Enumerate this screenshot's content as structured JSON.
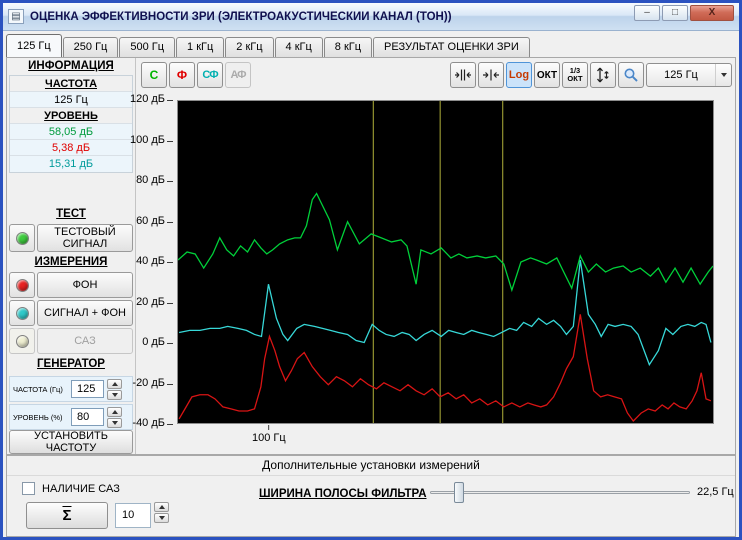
{
  "window": {
    "title": "ОЦЕНКА ЭФФЕКТИВНОСТИ ЗРИ (ЭЛЕКТРОАКУСТИЧЕСКИЙ КАНАЛ (ТОН))"
  },
  "icons": {
    "window_glyph": "▤",
    "minimize_glyph": "–",
    "maximize_glyph": "□",
    "close_glyph": "X"
  },
  "tabs": [
    {
      "label": "125 Гц",
      "active": true
    },
    {
      "label": "250 Гц",
      "active": false
    },
    {
      "label": "500 Гц",
      "active": false
    },
    {
      "label": "1 кГц",
      "active": false
    },
    {
      "label": "2 кГц",
      "active": false
    },
    {
      "label": "4 кГц",
      "active": false
    },
    {
      "label": "8 кГц",
      "active": false
    },
    {
      "label": "РЕЗУЛЬТАТ ОЦЕНКИ ЗРИ",
      "active": false
    }
  ],
  "sidebar": {
    "info_header": "ИНФОРМАЦИЯ",
    "frequency_header": "ЧАСТОТА",
    "frequency_value": "125 Гц",
    "level_header": "УРОВЕНЬ",
    "level_values": [
      {
        "text": "58,05 дБ",
        "color": "#009b3c"
      },
      {
        "text": "5,38 дБ",
        "color": "#e00000"
      },
      {
        "text": "15,31 дБ",
        "color": "#009b9b"
      }
    ],
    "test_header": "ТЕСТ",
    "test_led": "#3ecc3e",
    "test_button": "ТЕСТОВЫЙ СИГНАЛ",
    "measure_header": "ИЗМЕРЕНИЯ",
    "measure_buttons": [
      {
        "label": "ФОН",
        "led": "#e82222",
        "enabled": true
      },
      {
        "label": "СИГНАЛ + ФОН",
        "led": "#2fc9c9",
        "enabled": true
      },
      {
        "label": "САЗ",
        "led": "#efefd2",
        "enabled": false
      }
    ],
    "generator_header": "ГЕНЕРАТОР",
    "generator_fields": [
      {
        "label": "ЧАСТОТА (Гц)",
        "value": "125"
      },
      {
        "label": "УРОВЕНЬ (%)",
        "value": "80"
      }
    ],
    "set_frequency_button": "УСТАНОВИТЬ ЧАСТОТУ"
  },
  "toolbar": {
    "curve_toggles": [
      {
        "glyph": "С",
        "color": "#00b400",
        "enabled": true
      },
      {
        "glyph": "Ф",
        "color": "#e00000",
        "enabled": true
      },
      {
        "glyph": "СФ",
        "color": "#00b0b0",
        "enabled": true
      },
      {
        "glyph": "АФ",
        "color": "#ababab",
        "enabled": false
      }
    ],
    "log_button": "Log",
    "oct_button": "ОКТ",
    "third_oct_button": "1/3 ОКТ",
    "freq_dropdown": "125 Гц"
  },
  "chart_data": {
    "type": "line",
    "x_scale": "log",
    "background": "#000000",
    "ylim": [
      -40,
      120
    ],
    "grid": "off",
    "y_ticks": [
      {
        "value": 120,
        "label": "120 дБ"
      },
      {
        "value": 100,
        "label": "100 дБ"
      },
      {
        "value": 80,
        "label": "80 дБ"
      },
      {
        "value": 60,
        "label": "60 дБ"
      },
      {
        "value": 40,
        "label": "40 дБ"
      },
      {
        "value": 20,
        "label": "20 дБ"
      },
      {
        "value": 0,
        "label": "0 дБ"
      },
      {
        "value": -20,
        "label": "-20 дБ"
      },
      {
        "value": -40,
        "label": "-40 дБ"
      }
    ],
    "x_tick": {
      "fraction": 0.171,
      "label": "100 Гц"
    },
    "band_markers_fractions": [
      0.365,
      0.49,
      0.607
    ],
    "marker_color": "#b2b23a",
    "series": [
      {
        "name": "тестовый сигнал (С)",
        "color": "#00d03a",
        "points": [
          [
            0.0,
            41
          ],
          [
            0.017,
            45
          ],
          [
            0.032,
            44
          ],
          [
            0.048,
            37
          ],
          [
            0.065,
            44
          ],
          [
            0.078,
            52
          ],
          [
            0.091,
            46
          ],
          [
            0.104,
            43
          ],
          [
            0.117,
            48
          ],
          [
            0.13,
            45
          ],
          [
            0.143,
            51
          ],
          [
            0.155,
            47
          ],
          [
            0.166,
            44
          ],
          [
            0.177,
            46
          ],
          [
            0.19,
            49
          ],
          [
            0.205,
            51
          ],
          [
            0.218,
            52
          ],
          [
            0.229,
            52
          ],
          [
            0.24,
            58
          ],
          [
            0.251,
            71
          ],
          [
            0.259,
            74
          ],
          [
            0.283,
            61
          ],
          [
            0.298,
            46
          ],
          [
            0.317,
            60
          ],
          [
            0.339,
            49
          ],
          [
            0.361,
            54
          ],
          [
            0.38,
            52
          ],
          [
            0.399,
            50
          ],
          [
            0.417,
            51
          ],
          [
            0.428,
            48
          ],
          [
            0.445,
            29
          ],
          [
            0.454,
            46
          ],
          [
            0.473,
            44
          ],
          [
            0.492,
            47
          ],
          [
            0.51,
            42
          ],
          [
            0.525,
            44
          ],
          [
            0.54,
            42
          ],
          [
            0.559,
            43
          ],
          [
            0.575,
            42
          ],
          [
            0.594,
            43
          ],
          [
            0.609,
            39
          ],
          [
            0.624,
            26
          ],
          [
            0.641,
            40
          ],
          [
            0.659,
            42
          ],
          [
            0.67,
            41
          ],
          [
            0.689,
            39
          ],
          [
            0.708,
            42
          ],
          [
            0.736,
            27
          ],
          [
            0.752,
            43
          ],
          [
            0.767,
            35
          ],
          [
            0.782,
            39
          ],
          [
            0.799,
            35
          ],
          [
            0.814,
            37
          ],
          [
            0.832,
            38
          ],
          [
            0.847,
            35
          ],
          [
            0.864,
            37
          ],
          [
            0.883,
            33
          ],
          [
            0.898,
            37
          ],
          [
            0.912,
            30
          ],
          [
            0.929,
            37
          ],
          [
            0.944,
            30
          ],
          [
            0.959,
            37
          ],
          [
            0.976,
            29
          ],
          [
            0.991,
            35
          ],
          [
            1.0,
            38
          ]
        ]
      },
      {
        "name": "сигнал + фон (СФ)",
        "color": "#37d8d8",
        "points": [
          [
            0.002,
            5
          ],
          [
            0.022,
            6
          ],
          [
            0.041,
            6
          ],
          [
            0.06,
            7
          ],
          [
            0.078,
            7
          ],
          [
            0.093,
            8
          ],
          [
            0.112,
            7
          ],
          [
            0.128,
            6
          ],
          [
            0.143,
            4
          ],
          [
            0.156,
            3
          ],
          [
            0.169,
            29
          ],
          [
            0.184,
            12
          ],
          [
            0.196,
            4
          ],
          [
            0.205,
            1
          ],
          [
            0.222,
            7
          ],
          [
            0.236,
            9
          ],
          [
            0.255,
            8
          ],
          [
            0.27,
            7
          ],
          [
            0.285,
            6
          ],
          [
            0.3,
            5
          ],
          [
            0.317,
            4
          ],
          [
            0.333,
            1
          ],
          [
            0.348,
            0
          ],
          [
            0.363,
            9
          ],
          [
            0.376,
            6
          ],
          [
            0.389,
            4
          ],
          [
            0.404,
            3
          ],
          [
            0.419,
            5
          ],
          [
            0.432,
            4
          ],
          [
            0.445,
            1
          ],
          [
            0.46,
            4
          ],
          [
            0.475,
            6
          ],
          [
            0.492,
            3
          ],
          [
            0.506,
            6
          ],
          [
            0.52,
            5
          ],
          [
            0.534,
            4
          ],
          [
            0.549,
            6
          ],
          [
            0.562,
            5
          ],
          [
            0.577,
            4
          ],
          [
            0.59,
            3
          ],
          [
            0.605,
            5
          ],
          [
            0.62,
            7
          ],
          [
            0.633,
            6
          ],
          [
            0.646,
            10
          ],
          [
            0.661,
            8
          ],
          [
            0.674,
            12
          ],
          [
            0.689,
            9
          ],
          [
            0.702,
            11
          ],
          [
            0.715,
            8
          ],
          [
            0.726,
            4
          ],
          [
            0.739,
            8
          ],
          [
            0.752,
            41
          ],
          [
            0.767,
            14
          ],
          [
            0.78,
            9
          ],
          [
            0.791,
            3
          ],
          [
            0.804,
            9
          ],
          [
            0.817,
            8
          ],
          [
            0.832,
            9
          ],
          [
            0.847,
            8
          ],
          [
            0.86,
            4
          ],
          [
            0.881,
            -11
          ],
          [
            0.898,
            -4
          ],
          [
            0.912,
            7
          ],
          [
            0.925,
            4
          ],
          [
            0.94,
            8
          ],
          [
            0.953,
            9
          ],
          [
            0.966,
            8
          ],
          [
            0.978,
            10
          ],
          [
            0.987,
            9
          ],
          [
            0.996,
            0
          ]
        ]
      },
      {
        "name": "фон (Ф)",
        "color": "#d81414",
        "points": [
          [
            0.002,
            -38
          ],
          [
            0.013,
            -33
          ],
          [
            0.026,
            -27
          ],
          [
            0.041,
            -26
          ],
          [
            0.056,
            -26
          ],
          [
            0.069,
            -28
          ],
          [
            0.084,
            -32
          ],
          [
            0.099,
            -33
          ],
          [
            0.114,
            -34
          ],
          [
            0.13,
            -34
          ],
          [
            0.143,
            -33
          ],
          [
            0.155,
            -22
          ],
          [
            0.162,
            -8
          ],
          [
            0.171,
            3
          ],
          [
            0.181,
            -4
          ],
          [
            0.19,
            -12
          ],
          [
            0.201,
            -19
          ],
          [
            0.212,
            -14
          ],
          [
            0.223,
            -8
          ],
          [
            0.236,
            -5
          ],
          [
            0.251,
            -12
          ],
          [
            0.266,
            -17
          ],
          [
            0.281,
            -21
          ],
          [
            0.296,
            -17
          ],
          [
            0.311,
            -19
          ],
          [
            0.326,
            -22
          ],
          [
            0.341,
            -18
          ],
          [
            0.356,
            -21
          ],
          [
            0.371,
            -23
          ],
          [
            0.385,
            -20
          ],
          [
            0.4,
            -22
          ],
          [
            0.415,
            -24
          ],
          [
            0.43,
            -21
          ],
          [
            0.445,
            -24
          ],
          [
            0.46,
            -26
          ],
          [
            0.475,
            -23
          ],
          [
            0.49,
            -27
          ],
          [
            0.505,
            -25
          ],
          [
            0.52,
            -28
          ],
          [
            0.534,
            -26
          ],
          [
            0.549,
            -30
          ],
          [
            0.564,
            -28
          ],
          [
            0.579,
            -31
          ],
          [
            0.594,
            -29
          ],
          [
            0.609,
            -32
          ],
          [
            0.624,
            -30
          ],
          [
            0.639,
            -32
          ],
          [
            0.654,
            -30
          ],
          [
            0.665,
            -31
          ],
          [
            0.678,
            -32
          ],
          [
            0.689,
            -31
          ],
          [
            0.702,
            -27
          ],
          [
            0.715,
            -20
          ],
          [
            0.726,
            -13
          ],
          [
            0.739,
            -7
          ],
          [
            0.752,
            14
          ],
          [
            0.765,
            -8
          ],
          [
            0.777,
            -24
          ],
          [
            0.79,
            -27
          ],
          [
            0.803,
            -26
          ],
          [
            0.816,
            -27
          ],
          [
            0.829,
            -28
          ],
          [
            0.84,
            -35
          ],
          [
            0.851,
            -39
          ],
          [
            0.866,
            -35
          ],
          [
            0.879,
            -33
          ],
          [
            0.892,
            -34
          ],
          [
            0.905,
            -31
          ],
          [
            0.916,
            -33
          ],
          [
            0.927,
            -30
          ],
          [
            0.938,
            -32
          ],
          [
            0.95,
            -33
          ],
          [
            0.961,
            -29
          ],
          [
            0.97,
            -24
          ],
          [
            0.978,
            -15
          ],
          [
            0.987,
            -28
          ],
          [
            0.996,
            -29
          ]
        ]
      }
    ]
  },
  "footer": {
    "panel_title": "Дополнительные установки измерений",
    "saz_checkbox_label": "НАЛИЧИЕ САЗ",
    "saz_checked": false,
    "sum_button": "Σ",
    "sum_count": "10",
    "filter_label": "ШИРИНА ПОЛОСЫ ФИЛЬТРА",
    "filter_value": "22,5 Гц",
    "slider_fraction": 0.11
  }
}
